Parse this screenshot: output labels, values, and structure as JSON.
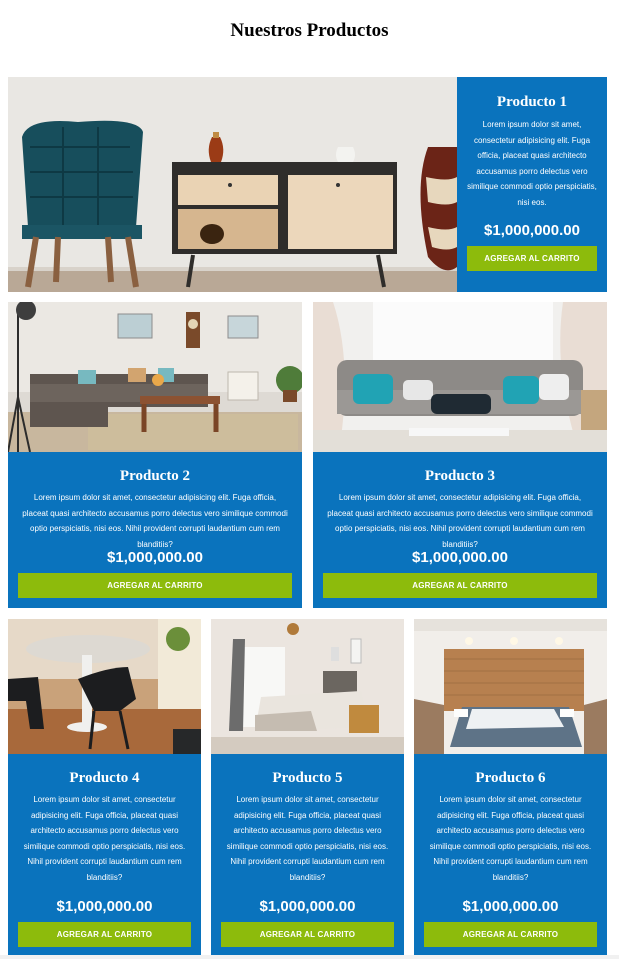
{
  "page": {
    "title": "Nuestros Productos"
  },
  "products": [
    {
      "name": "Producto 1",
      "description": "Lorem ipsum dolor sit amet, consectetur adipisicing elit. Fuga officia, placeat quasi architecto accusamus porro delectus vero similique commodi optio perspiciatis, nisi eos.",
      "price": "$1,000,000.00",
      "button_label": "AGREGAR AL CARRITO",
      "image": "living-room-sideboard-chair"
    },
    {
      "name": "Producto 2",
      "description": "Lorem ipsum dolor sit amet, consectetur adipisicing elit. Fuga officia, placeat quasi architecto accusamus porro delectus vero similique commodi optio perspiciatis, nisi eos. Nihil provident corrupti laudantium cum rem blanditiis?",
      "price": "$1,000,000.00",
      "button_label": "AGREGAR AL CARRITO",
      "image": "living-room-sectional-sofa"
    },
    {
      "name": "Producto 3",
      "description": "Lorem ipsum dolor sit amet, consectetur adipisicing elit. Fuga officia, placeat quasi architecto accusamus porro delectus vero similique commodi optio perspiciatis, nisi eos. Nihil provident corrupti laudantium cum rem blanditiis?",
      "price": "$1,000,000.00",
      "button_label": "AGREGAR AL CARRITO",
      "image": "grey-tufted-sofa"
    },
    {
      "name": "Producto 4",
      "description": "Lorem ipsum dolor sit amet, consectetur adipisicing elit. Fuga officia, placeat quasi architecto accusamus porro delectus vero similique commodi optio perspiciatis, nisi eos. Nihil provident corrupti laudantium cum rem blanditiis?",
      "price": "$1,000,000.00",
      "button_label": "AGREGAR AL CARRITO",
      "image": "dining-table-chairs"
    },
    {
      "name": "Producto 5",
      "description": "Lorem ipsum dolor sit amet, consectetur adipisicing elit. Fuga officia, placeat quasi architecto accusamus porro delectus vero similique commodi optio perspiciatis, nisi eos. Nihil provident corrupti laudantium cum rem blanditiis?",
      "price": "$1,000,000.00",
      "button_label": "AGREGAR AL CARRITO",
      "image": "bedroom-window"
    },
    {
      "name": "Producto 6",
      "description": "Lorem ipsum dolor sit amet, consectetur adipisicing elit. Fuga officia, placeat quasi architecto accusamus porro delectus vero similique commodi optio perspiciatis, nisi eos. Nihil provident corrupti laudantium cum rem blanditiis?",
      "price": "$1,000,000.00",
      "button_label": "AGREGAR AL CARRITO",
      "image": "bedroom-wood-wall"
    }
  ],
  "colors": {
    "card_bg": "#0a73bd",
    "button_bg": "#8dbb0c",
    "text": "#ffffff"
  }
}
